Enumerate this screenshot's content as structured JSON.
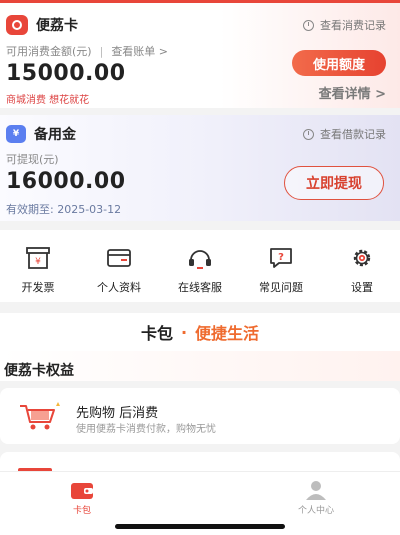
{
  "card1": {
    "title": "便荔卡",
    "record_link": "查看消费记录",
    "sub_label": "可用消费金额(元)",
    "bill_link": "查看账单 >",
    "amount": "15000.00",
    "slogan": "商城消费 想花就花",
    "quota_button": "使用额度",
    "detail_link": "查看详情 >"
  },
  "card2": {
    "title": "备用金",
    "record_link": "查看借款记录",
    "sub_label": "可提现(元)",
    "amount": "16000.00",
    "expiry": "有效期至: 2025-03-12",
    "withdraw_button": "立即提现"
  },
  "grid": [
    {
      "label": "开发票",
      "icon": "invoice-icon"
    },
    {
      "label": "个人资料",
      "icon": "profile-card-icon"
    },
    {
      "label": "在线客服",
      "icon": "headset-icon"
    },
    {
      "label": "常见问题",
      "icon": "faq-icon"
    },
    {
      "label": "设置",
      "icon": "gear-icon"
    }
  ],
  "banner": {
    "left": "卡包",
    "dot": "·",
    "right": "便捷生活"
  },
  "section": {
    "title": "便荔卡权益"
  },
  "benefits": [
    {
      "title": "先购物 后消费",
      "desc": "使用便荔卡消费付款，购物无忧",
      "icon": "shopping-cart-icon"
    }
  ],
  "tabs": [
    {
      "label": "卡包",
      "icon": "wallet-icon",
      "active": true
    },
    {
      "label": "个人中心",
      "icon": "person-icon",
      "active": false
    }
  ],
  "colors": {
    "accent": "#e8463a",
    "orange": "#ef6b2f",
    "blue": "#5b7ff0"
  }
}
